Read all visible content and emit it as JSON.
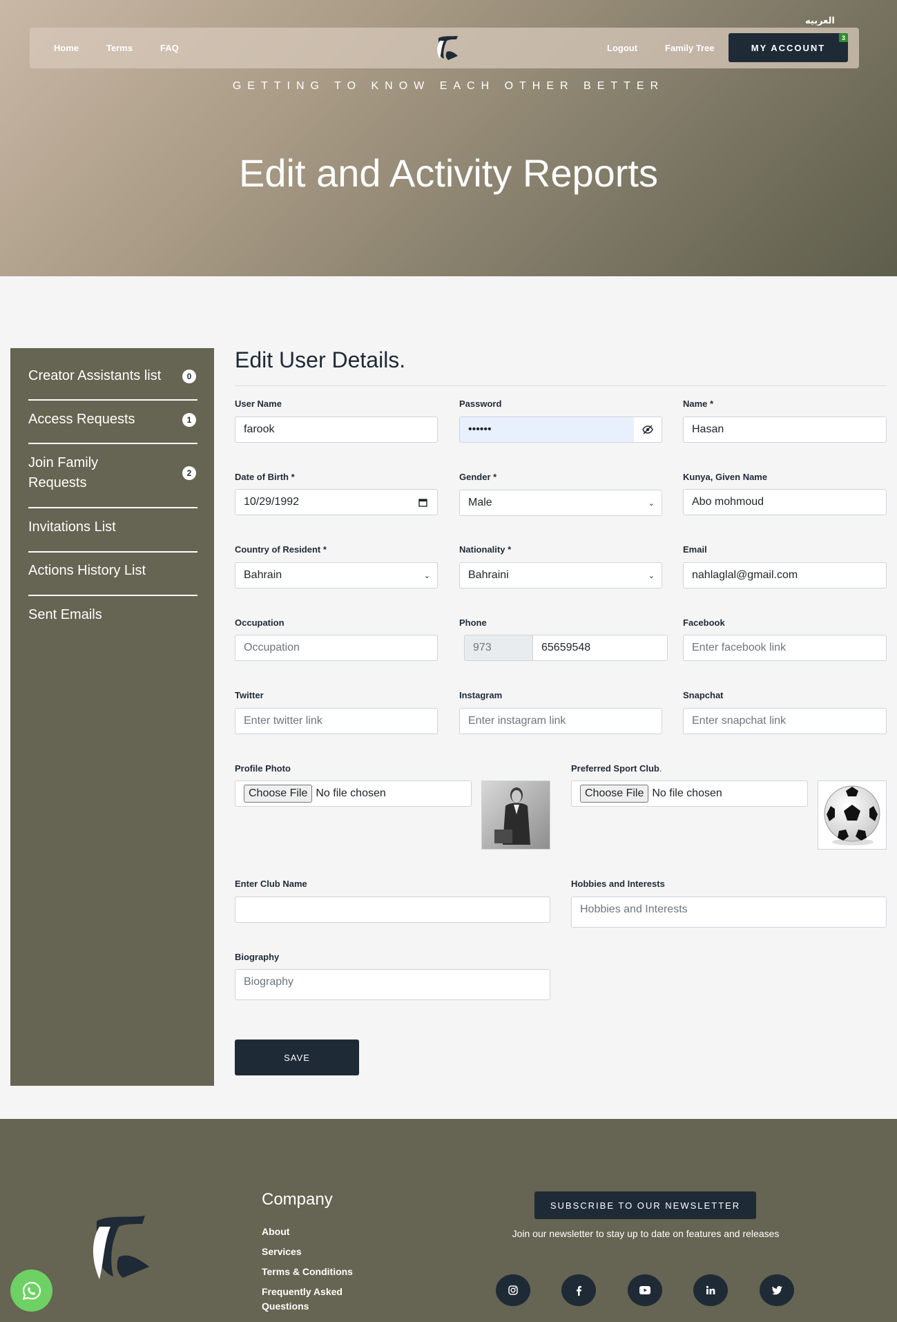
{
  "header": {
    "language_link": "العربيه",
    "nav_left": [
      "Home",
      "Terms",
      "FAQ"
    ],
    "nav_right": [
      "Logout",
      "Family Tree"
    ],
    "account_button": "MY ACCOUNT",
    "account_badge": "3",
    "tagline": "GETTING TO KNOW EACH OTHER BETTER",
    "title": "Edit and Activity Reports"
  },
  "sidebar": {
    "items": [
      {
        "label": "Creator Assistants list",
        "badge": "0"
      },
      {
        "label": "Access Requests",
        "badge": "1"
      },
      {
        "label": "Join Family Requests",
        "badge": "2"
      },
      {
        "label": "Invitations List"
      },
      {
        "label": "Actions History List"
      },
      {
        "label": "Sent Emails"
      }
    ]
  },
  "form": {
    "title": "Edit User Details.",
    "username": {
      "label": "User Name",
      "value": "farook"
    },
    "password": {
      "label": "Password",
      "value": "••••••"
    },
    "name": {
      "label": "Name *",
      "value": "Hasan"
    },
    "dob": {
      "label": "Date of Birth *",
      "value": "10/29/1992"
    },
    "gender": {
      "label": "Gender *",
      "value": "Male"
    },
    "kunya": {
      "label": "Kunya, Given Name",
      "value": "Abo mohmoud"
    },
    "country": {
      "label": "Country of Resident *",
      "value": "Bahrain"
    },
    "nationality": {
      "label": "Nationality *",
      "value": "Bahraini"
    },
    "email": {
      "label": "Email",
      "value": "nahlaglal@gmail.com"
    },
    "occupation": {
      "label": "Occupation",
      "placeholder": "Occupation"
    },
    "phone": {
      "label": "Phone",
      "code": "973",
      "value": "65659548"
    },
    "facebook": {
      "label": "Facebook",
      "placeholder": "Enter facebook link"
    },
    "twitter": {
      "label": "Twitter",
      "placeholder": "Enter twitter link"
    },
    "instagram": {
      "label": "Instagram",
      "placeholder": "Enter instagram link"
    },
    "snapchat": {
      "label": "Snapchat",
      "placeholder": "Enter snapchat link"
    },
    "profile_photo": {
      "label": "Profile Photo",
      "button": "Choose File",
      "status": "No file chosen"
    },
    "sport_club": {
      "label": "Preferred Sport Club",
      "suffix": ".",
      "button": "Choose File",
      "status": "No file chosen"
    },
    "club_name": {
      "label": "Enter Club Name",
      "value": ""
    },
    "hobbies": {
      "label": "Hobbies and Interests",
      "placeholder": "Hobbies and Interests"
    },
    "biography": {
      "label": "Biography",
      "placeholder": "Biography"
    },
    "save_label": "SAVE"
  },
  "footer": {
    "company_title": "Company",
    "links": [
      "About",
      "Services",
      "Terms & Conditions",
      "Frequently Asked Questions"
    ],
    "subscribe_button": "SUBSCRIBE TO OUR NEWSLETTER",
    "subscribe_text": "Join our newsletter to stay up to date on features and releases",
    "social_icons": [
      "instagram-icon",
      "facebook-icon",
      "youtube-icon",
      "linkedin-icon",
      "twitter-icon"
    ]
  },
  "colors": {
    "brand_dark": "#1f2a37",
    "olive": "#666452",
    "whatsapp": "#6ed163"
  }
}
